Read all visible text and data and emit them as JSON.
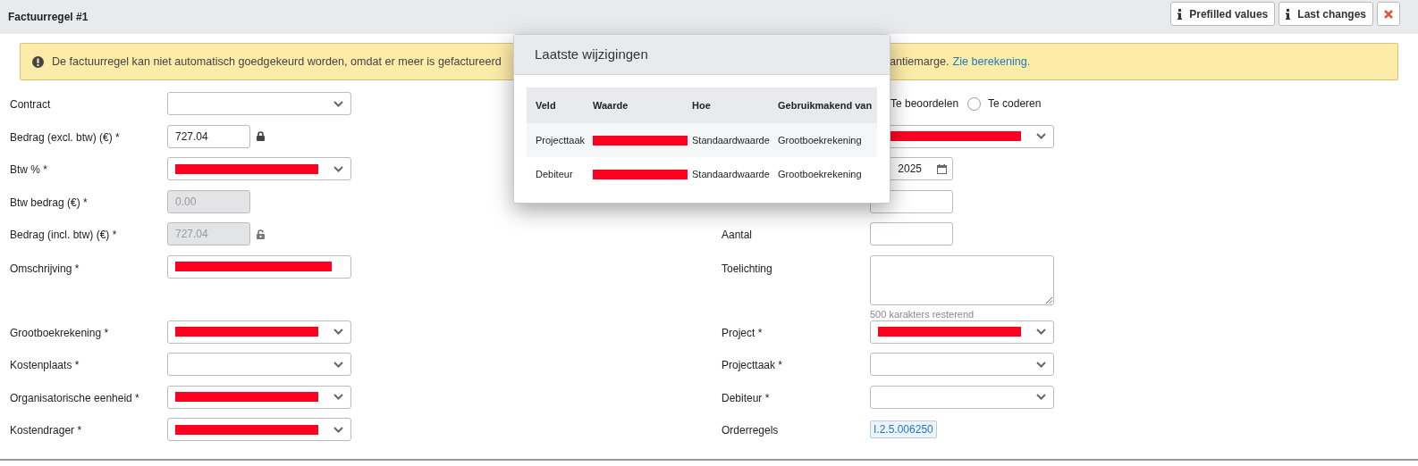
{
  "header": {
    "title": "Factuurregel #1",
    "buttons": [
      {
        "kind": "info",
        "label": "Prefilled values"
      },
      {
        "kind": "info",
        "label": "Last changes"
      },
      {
        "kind": "close"
      }
    ]
  },
  "alert": {
    "text": "De factuurregel kan niet automatisch goedgekeurd worden, omdat er meer is gefactureerd",
    "text_after": "antiemarge.",
    "link": "Zie berekening."
  },
  "left_fields": [
    {
      "label": "Contract",
      "kind": "select"
    },
    {
      "label": "Bedrag (excl. btw) (€) *",
      "kind": "input",
      "value": "727.04",
      "disabled": false,
      "locked": true
    },
    {
      "label": "Btw % *",
      "kind": "select",
      "redacted": true
    },
    {
      "label": "Btw bedrag (€) *",
      "kind": "input",
      "value": "0.00",
      "disabled": true
    },
    {
      "label": "Bedrag (incl. btw) (€) *",
      "kind": "input",
      "value": "727.04",
      "disabled": true,
      "locked": false
    },
    {
      "label": "Omschrijving *",
      "kind": "text",
      "redacted": true
    },
    {
      "label": "Grootboekrekening *",
      "kind": "select",
      "redacted": true
    },
    {
      "label": "Kostenplaats *",
      "kind": "select"
    },
    {
      "label": "Organisatorische eenheid *",
      "kind": "select",
      "redacted": true
    },
    {
      "label": "Kostendrager *",
      "kind": "select",
      "redacted": true
    }
  ],
  "right_fields": [
    {
      "kind": "radios",
      "options": [
        {
          "label": "Te beoordelen"
        },
        {
          "label": "Te coderen",
          "selected": false
        }
      ]
    },
    {
      "kind": "select",
      "redacted": true
    },
    {
      "kind": "date",
      "value": "2025"
    },
    {
      "kind": "input"
    },
    {
      "label": "Aantal",
      "kind": "input"
    },
    {
      "label": "Toelichting",
      "kind": "textarea",
      "hint": "500 karakters resterend"
    },
    {
      "label": "Project *",
      "kind": "select",
      "redacted": true
    },
    {
      "label": "Projecttaak *",
      "kind": "select"
    },
    {
      "label": "Debiteur *",
      "kind": "select"
    },
    {
      "label": "Orderregels",
      "kind": "badge",
      "value": "I.2.5.006250"
    }
  ],
  "popover": {
    "title": "Laatste wijzigingen",
    "columns": [
      "Veld",
      "Waarde",
      "Hoe",
      "Gebruikmakend van"
    ],
    "rows": [
      {
        "veld": "Projecttaak",
        "redacted": true,
        "hoe": "Standaardwaarde",
        "via": "Grootboekrekening"
      },
      {
        "veld": "Debiteur",
        "redacted": true,
        "hoe": "Standaardwaarde",
        "via": "Grootboekrekening"
      }
    ]
  }
}
